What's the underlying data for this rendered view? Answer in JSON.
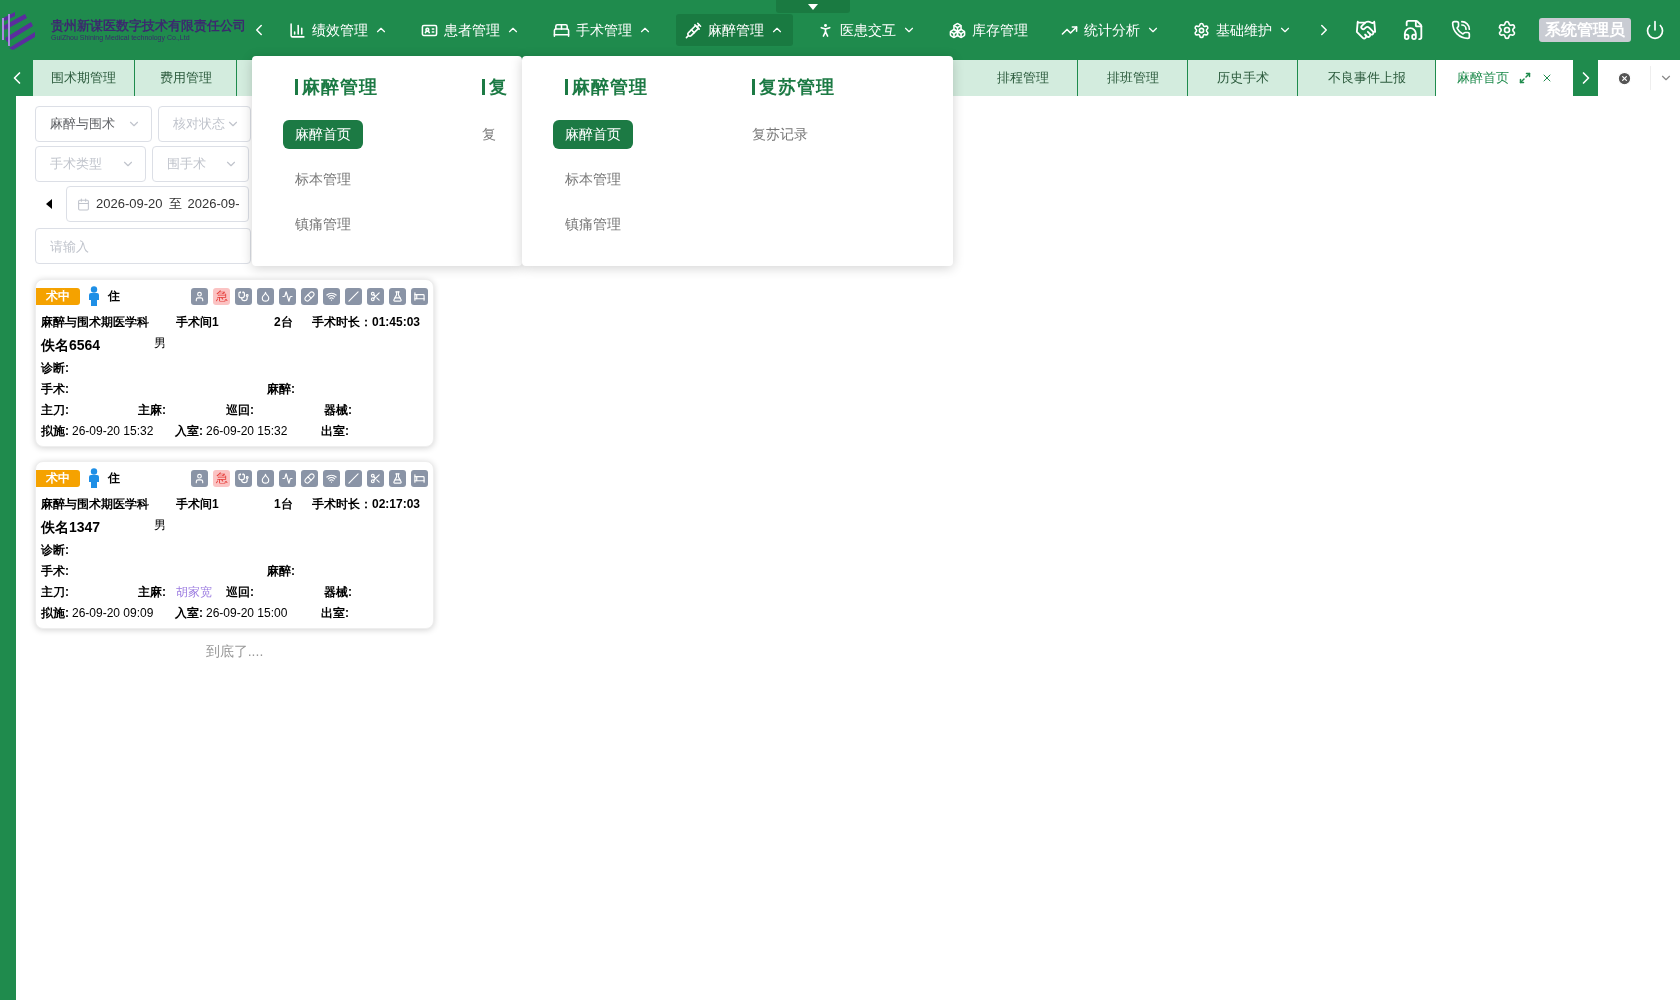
{
  "header": {
    "company_name": "贵州新谋医数字技术有限责任公司",
    "company_name_en": "GuiZhou Shining Medical technology Co.,Ltd",
    "nav": [
      {
        "label": "绩效管理",
        "kind": "menu",
        "expanded": true,
        "selected": false
      },
      {
        "label": "患者管理",
        "kind": "menu",
        "expanded": true,
        "selected": false
      },
      {
        "label": "手术管理",
        "kind": "menu",
        "expanded": true,
        "selected": false
      },
      {
        "label": "麻醉管理",
        "kind": "menu",
        "expanded": true,
        "selected": true
      },
      {
        "label": "医患交互",
        "kind": "menu",
        "expanded": false,
        "selected": false
      },
      {
        "label": "库存管理",
        "kind": "link",
        "selected": false
      },
      {
        "label": "统计分析",
        "kind": "menu",
        "expanded": false,
        "selected": false
      },
      {
        "label": "基础维护",
        "kind": "menu",
        "expanded": false,
        "selected": false
      }
    ],
    "user": "系统管理员"
  },
  "tabs_left": [
    {
      "label": "围术期管理",
      "selected": false
    },
    {
      "label": "费用管理",
      "selected": false
    }
  ],
  "tabs_right": [
    {
      "label": "排程管理",
      "selected": false
    },
    {
      "label": "排班管理",
      "selected": false
    },
    {
      "label": "历史手术",
      "selected": false
    },
    {
      "label": "不良事件上报",
      "selected": false
    },
    {
      "label": "麻醉首页",
      "selected": true
    }
  ],
  "filters": {
    "department": {
      "value": "麻醉与围术"
    },
    "check_status": {
      "placeholder": "核对状态"
    },
    "surgery_type": {
      "placeholder": "手术类型"
    },
    "period": {
      "placeholder": "围手术"
    },
    "date_range": {
      "start": "2026-09-20",
      "separator": "至",
      "end": "2026-09-"
    },
    "search": {
      "placeholder": "请输入"
    }
  },
  "cards": [
    {
      "status": "术中",
      "patient_type": "住",
      "urgent": {
        "text": "急",
        "on": true
      },
      "department": "麻醉与围术期医学科",
      "room": "手术间1",
      "count": "2台",
      "duration_label": "手术时长：",
      "duration": "01:45:03",
      "name": "佚名6564",
      "gender": "男",
      "diagnosis_label": "诊断:",
      "surgery_label": "手术:",
      "anesthesia_label": "麻醉:",
      "surgeon_label": "主刀:",
      "anesthetist_label": "主麻:",
      "circulating_label": "巡回:",
      "instrument_label": "器械:",
      "planned_label": "拟施:",
      "planned": "26-09-20 15:32",
      "in_room_label": "入室:",
      "in_room": "26-09-20 15:32",
      "out_room_label": "出室:"
    },
    {
      "status": "术中",
      "patient_type": "住",
      "urgent": {
        "text": "急",
        "on": true
      },
      "department": "麻醉与围术期医学科",
      "room": "手术间1",
      "count": "1台",
      "duration_label": "手术时长：",
      "duration": "02:17:03",
      "name": "佚名1347",
      "gender": "男",
      "diagnosis_label": "诊断:",
      "surgery_label": "手术:",
      "anesthesia_label": "麻醉:",
      "surgeon_label": "主刀:",
      "anesthetist_label": "主麻:",
      "anesthetist": "胡家宽",
      "circulating_label": "巡回:",
      "instrument_label": "器械:",
      "planned_label": "拟施:",
      "planned": "26-09-20 09:09",
      "in_room_label": "入室:",
      "in_room": "26-09-20 15:00",
      "out_room_label": "出室:"
    }
  ],
  "end_text": "到底了....",
  "menu_panels": [
    {
      "columns": [
        {
          "title": "麻醉管理",
          "items": [
            {
              "label": "麻醉首页",
              "selected": true
            },
            {
              "label": "标本管理",
              "selected": false
            },
            {
              "label": "镇痛管理",
              "selected": false
            }
          ]
        },
        {
          "title": "复",
          "items": [
            {
              "label": "复",
              "selected": false
            }
          ]
        }
      ]
    },
    {
      "columns": [
        {
          "title": "麻醉管理",
          "items": [
            {
              "label": "麻醉首页",
              "selected": true
            },
            {
              "label": "标本管理",
              "selected": false
            },
            {
              "label": "镇痛管理",
              "selected": false
            }
          ]
        },
        {
          "title": "复苏管理",
          "items": [
            {
              "label": "复苏记录",
              "selected": false
            }
          ]
        }
      ]
    }
  ]
}
